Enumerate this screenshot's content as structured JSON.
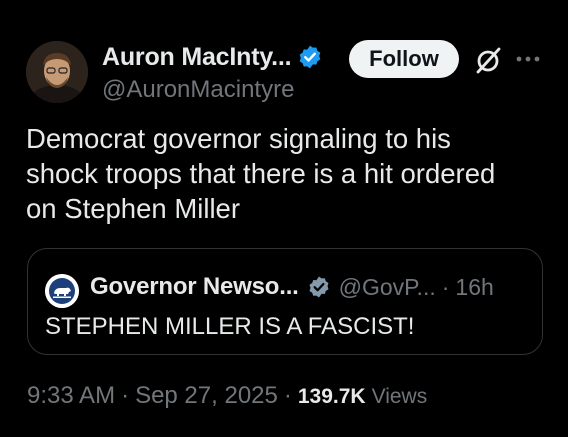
{
  "author": {
    "display_name": "Auron MacInty...",
    "handle": "@AuronMacintyre",
    "verified": true,
    "badge_color": "#1d9bf0"
  },
  "actions": {
    "follow_label": "Follow",
    "grok_icon": "grok-icon",
    "more_icon": "more-dots-icon"
  },
  "tweet": {
    "lines": [
      "Democrat governor signaling to his",
      "shock troops that there is a hit ordered",
      "on Stephen Miller"
    ]
  },
  "quote": {
    "display_name": "Governor Newso...",
    "handle": "@GovP...",
    "separator": "·",
    "time": "16h",
    "text": "STEPHEN MILLER IS A FASCIST!",
    "badge_color": "#829aab"
  },
  "meta": {
    "time": "9:33 AM",
    "separator": "·",
    "date": "Sep 27, 2025",
    "view_count": "139.7K",
    "views_label": "Views"
  },
  "colors": {
    "background": "#000000",
    "primary_text": "#e7e9ea",
    "secondary_text": "#71767b",
    "border": "#2f3336"
  }
}
